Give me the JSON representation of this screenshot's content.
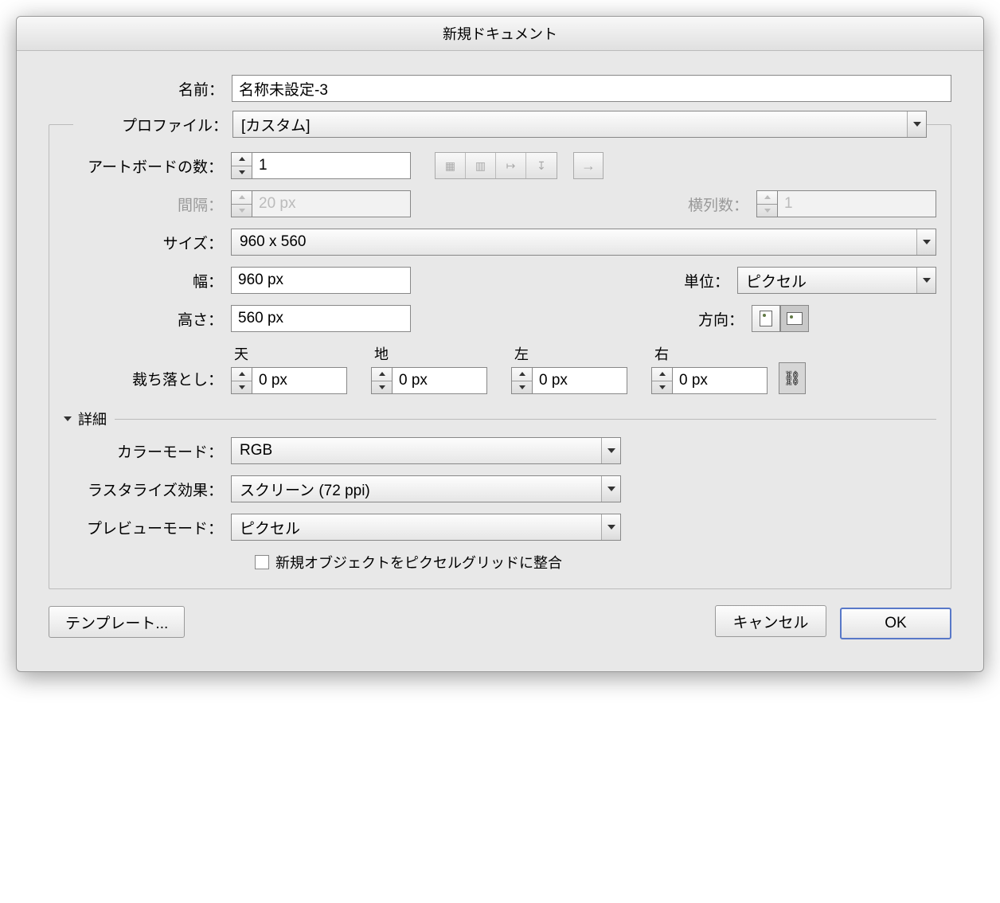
{
  "title": "新規ドキュメント",
  "labels": {
    "name": "名前：",
    "profile": "プロファイル：",
    "artboards": "アートボードの数：",
    "spacing": "間隔：",
    "columns": "横列数：",
    "size": "サイズ：",
    "width": "幅：",
    "height": "高さ：",
    "units": "単位：",
    "orientation": "方向：",
    "bleed": "裁ち落とし：",
    "bleedTop": "天",
    "bleedBottom": "地",
    "bleedLeft": "左",
    "bleedRight": "右",
    "details": "詳細",
    "colorMode": "カラーモード：",
    "rasterEffects": "ラスタライズ効果：",
    "previewMode": "プレビューモード：",
    "alignToGrid": "新規オブジェクトをピクセルグリッドに整合",
    "templateBtn": "テンプレート...",
    "cancelBtn": "キャンセル",
    "okBtn": "OK"
  },
  "values": {
    "name": "名称未設定-3",
    "profile": "[カスタム]",
    "artboards": "1",
    "spacing": "20 px",
    "columns": "1",
    "size": "960 x 560",
    "width": "960 px",
    "height": "560 px",
    "units": "ピクセル",
    "bleedTop": "0 px",
    "bleedBottom": "0 px",
    "bleedLeft": "0 px",
    "bleedRight": "0 px",
    "colorMode": "RGB",
    "rasterEffects": "スクリーン (72 ppi)",
    "previewMode": "ピクセル",
    "alignToGrid": false,
    "orientation": "landscape"
  }
}
